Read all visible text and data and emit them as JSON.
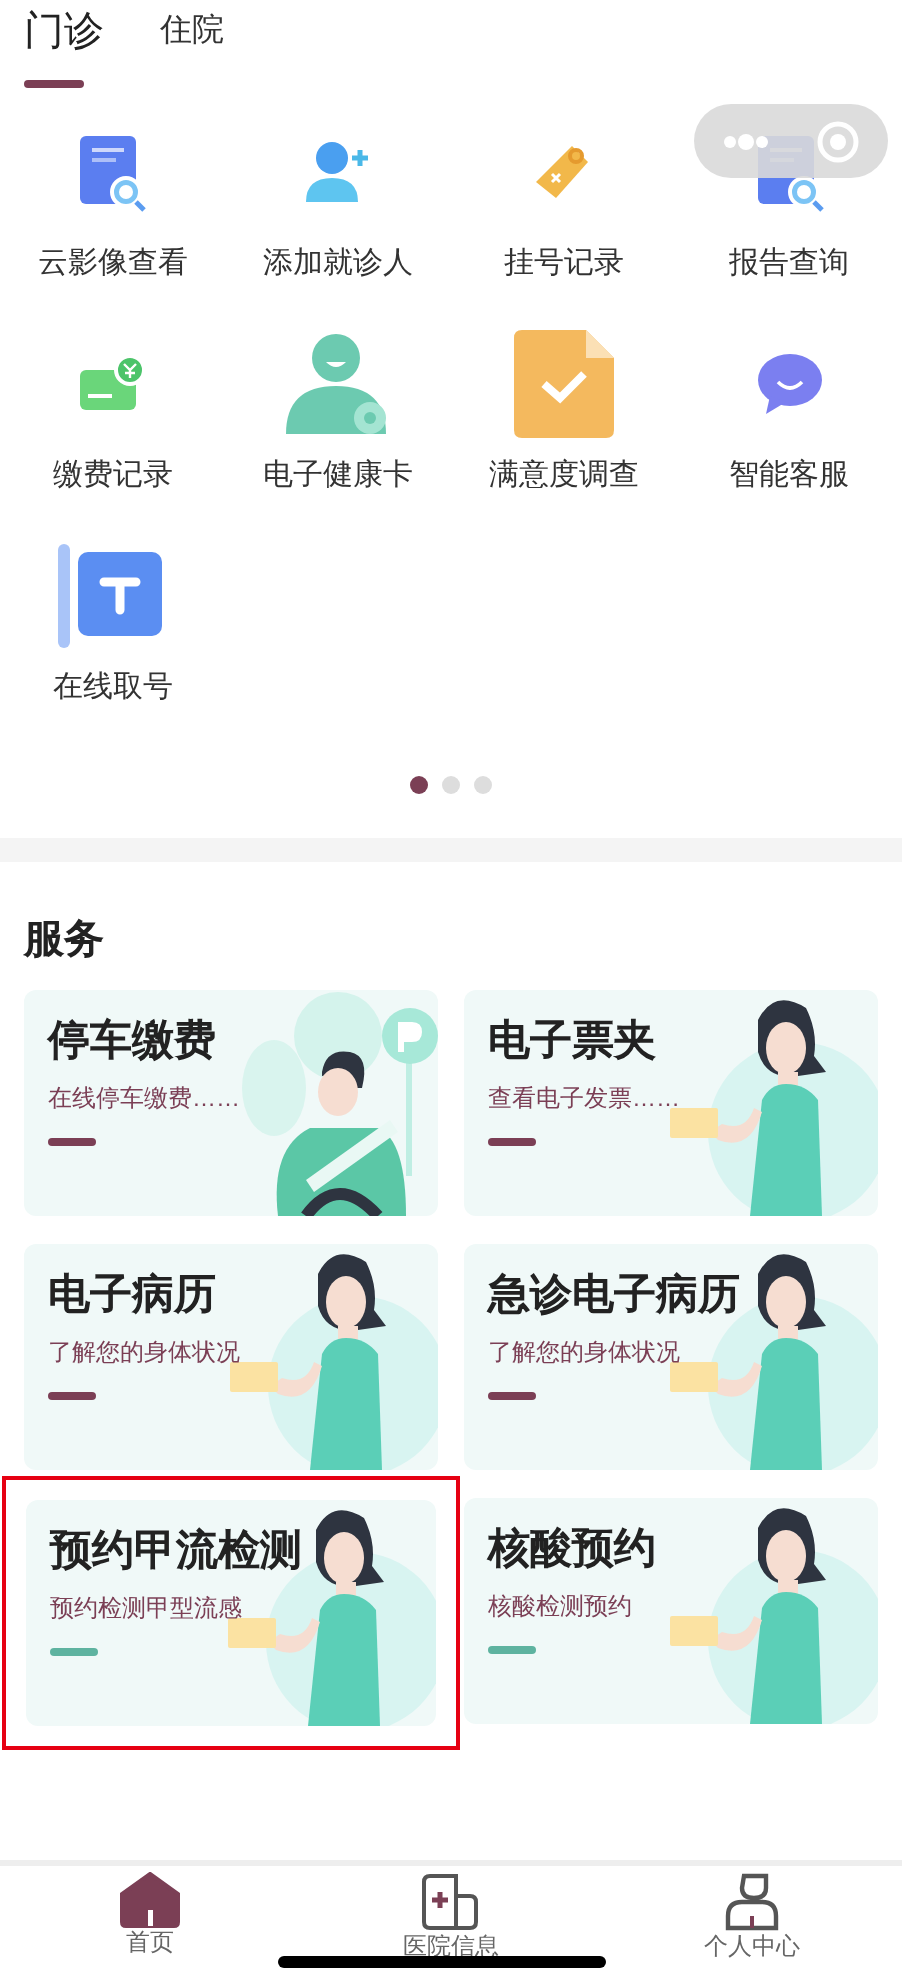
{
  "tabs": [
    {
      "label": "门诊",
      "selected": true
    },
    {
      "label": "住院",
      "selected": false
    }
  ],
  "quick_actions": [
    {
      "label": "云影像查看",
      "kind": "doc-search"
    },
    {
      "label": "添加就诊人",
      "kind": "person-add"
    },
    {
      "label": "挂号记录",
      "kind": "tag"
    },
    {
      "label": "报告查询",
      "kind": "doc-search"
    },
    {
      "label": "缴费记录",
      "kind": "payment"
    },
    {
      "label": "电子健康卡",
      "kind": "health-card"
    },
    {
      "label": "满意度调查",
      "kind": "survey"
    },
    {
      "label": "智能客服",
      "kind": "chat"
    },
    {
      "label": "在线取号",
      "kind": "ticket"
    }
  ],
  "pager": [
    {
      "selected": true
    },
    {
      "selected": false
    },
    {
      "selected": false
    }
  ],
  "services": {
    "title": "服务",
    "cards": [
      {
        "title": "停车缴费",
        "subtitle": "在线停车缴费……",
        "color": "#7b3f55",
        "kind": "driver",
        "highlighted": false
      },
      {
        "title": "电子票夹",
        "subtitle": "查看电子发票……",
        "color": "#7b3f55",
        "kind": "woman",
        "highlighted": false
      },
      {
        "title": "电子病历",
        "subtitle": "了解您的身体状况",
        "color": "#7b3f55",
        "kind": "woman",
        "highlighted": false
      },
      {
        "title": "急诊电子病历",
        "subtitle": "了解您的身体状况",
        "color": "#7b3f55",
        "kind": "woman",
        "highlighted": false
      },
      {
        "title": "预约甲流检测",
        "subtitle": "预约检测甲型流感",
        "color": "#5eb3a0",
        "kind": "woman",
        "highlighted": true
      },
      {
        "title": "核酸预约",
        "subtitle": "核酸检测预约",
        "color": "#5eb3a0",
        "kind": "woman",
        "highlighted": false
      }
    ]
  },
  "bottom_nav": [
    {
      "label": "首页",
      "kind": "home",
      "selected": true
    },
    {
      "label": "医院信息",
      "kind": "hospital",
      "selected": false
    },
    {
      "label": "个人中心",
      "kind": "person",
      "selected": false
    }
  ]
}
